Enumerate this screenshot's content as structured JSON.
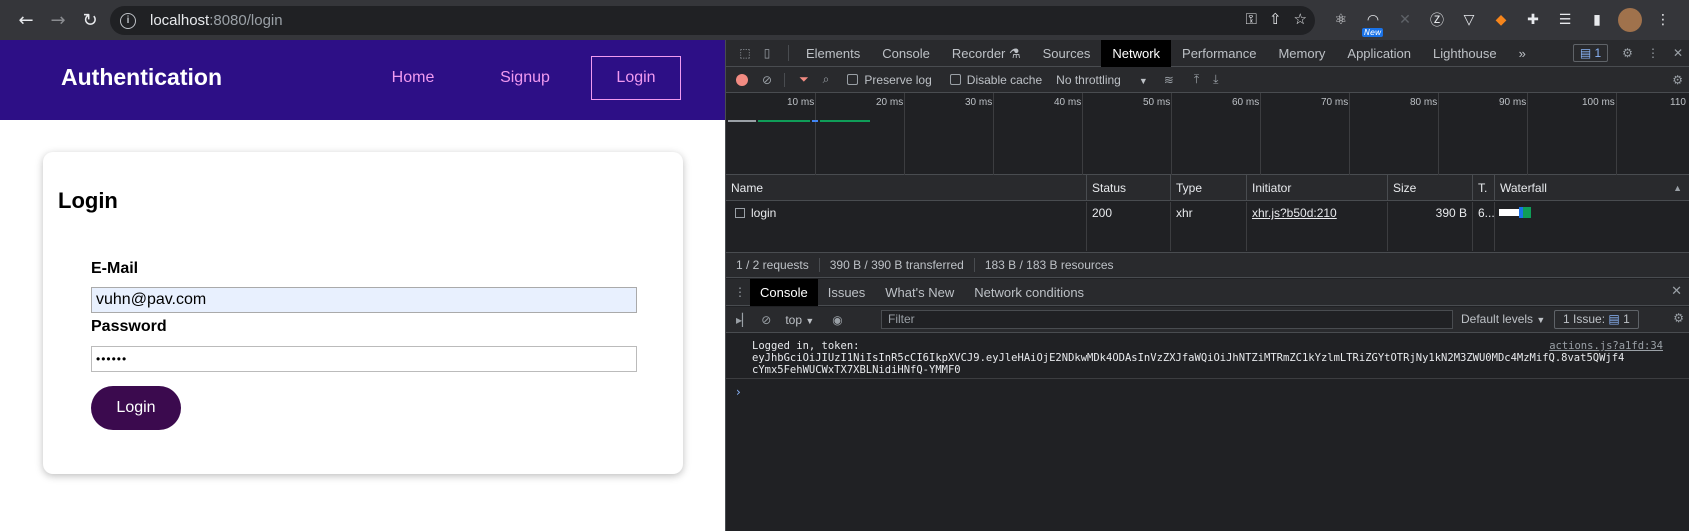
{
  "browser": {
    "url_host": "localhost",
    "url_path": ":8080/login",
    "ext_new_badge": "New"
  },
  "app": {
    "brand": "Authentication",
    "nav": {
      "home": "Home",
      "signup": "Signup",
      "login": "Login"
    },
    "form": {
      "title": "Login",
      "email_label": "E-Mail",
      "email_value": "vuhn@pav.com",
      "password_label": "Password",
      "password_value": "••••••",
      "submit_label": "Login"
    }
  },
  "devtools": {
    "tabs": [
      "Elements",
      "Console",
      "Recorder ⚗",
      "Sources",
      "Network",
      "Performance",
      "Memory",
      "Application",
      "Lighthouse"
    ],
    "active_tab": "Network",
    "issues_count": "1",
    "toolbar": {
      "preserve_log": "Preserve log",
      "disable_cache": "Disable cache",
      "throttling": "No throttling"
    },
    "timeline_ticks": [
      "10 ms",
      "20 ms",
      "30 ms",
      "40 ms",
      "50 ms",
      "60 ms",
      "70 ms",
      "80 ms",
      "90 ms",
      "100 ms",
      "110"
    ],
    "table": {
      "headers": [
        "Name",
        "Status",
        "Type",
        "Initiator",
        "Size",
        "T.",
        "Waterfall"
      ],
      "rows": [
        {
          "name": "login",
          "status": "200",
          "type": "xhr",
          "initiator": "xhr.js?b50d:210",
          "size": "390 B",
          "time": "6..."
        }
      ]
    },
    "summary": [
      "1 / 2 requests",
      "390 B / 390 B transferred",
      "183 B / 183 B resources"
    ],
    "drawer_tabs": [
      "Console",
      "Issues",
      "What's New",
      "Network conditions"
    ],
    "console": {
      "context": "top",
      "filter_placeholder": "Filter",
      "levels": "Default levels",
      "issues_label": "1 Issue:",
      "issues_count": "1",
      "message_line1": "Logged in, token:",
      "message_line2": "eyJhbGciOiJIUzI1NiIsInR5cCI6IkpXVCJ9.eyJleHAiOjE2NDkwMDk4ODAsInVzZXJfaWQiOiJhNTZiMTRmZC1kYzlmLTRiZGYtOTRjNy1kN2M3ZWU0MDc4MzMifQ.8vat5QWjf4",
      "message_line3": "cYmx5FehWUCWxTX7XBLNidiHNfQ-YMMF0",
      "source": "actions.js?a1fd:34"
    },
    "colors": {
      "accent_blue": "#8ab4f8",
      "record_red": "#f28b82",
      "header_purple": "#2d0f86",
      "nav_pink": "#f09af0",
      "button_dark": "#3b0a4e"
    }
  }
}
